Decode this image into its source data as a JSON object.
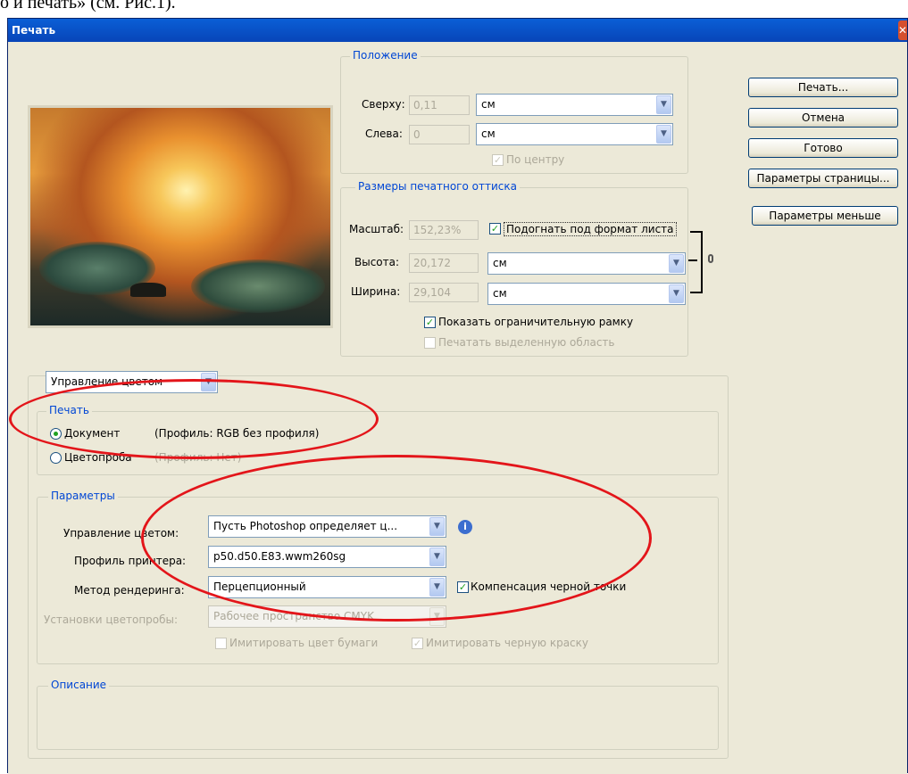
{
  "doc_text": "о и печать» (см. Рис.1).",
  "window": {
    "title": "Печать"
  },
  "position": {
    "legend": "Положение",
    "top_label": "Сверху:",
    "top_value": "0,11",
    "top_unit": "см",
    "left_label": "Слева:",
    "left_value": "0",
    "left_unit": "см",
    "center_label": "По центру"
  },
  "print_size": {
    "legend": "Размеры печатного оттиска",
    "scale_label": "Масштаб:",
    "scale_value": "152,23%",
    "fit_label": "Подогнать под формат листа",
    "height_label": "Высота:",
    "height_value": "20,172",
    "height_unit": "см",
    "width_label": "Ширина:",
    "width_value": "29,104",
    "width_unit": "см",
    "bbox_label": "Показать ограничительную рамку",
    "print_selection_label": "Печатать выделенную область"
  },
  "buttons": {
    "print": "Печать...",
    "cancel": "Отмена",
    "done": "Готово",
    "page_setup": "Параметры страницы...",
    "fewer_options": "Параметры меньше"
  },
  "color_mgmt": {
    "dropdown": "Управление цветом",
    "print_legend": "Печать",
    "document_label": "Документ",
    "document_profile": "(Профиль: RGB без профиля)",
    "proof_label": "Цветопроба",
    "proof_profile": "(Профиль: Нет)"
  },
  "options": {
    "legend": "Параметры",
    "cm_label": "Управление цветом:",
    "cm_value": "Пусть Photoshop определяет ц...",
    "printer_label": "Профиль принтера:",
    "printer_value": "p50.d50.E83.wwm260sg",
    "render_label": "Метод рендеринга:",
    "render_value": "Перцепционный",
    "bpc_label": "Компенсация черной точки",
    "proof_setup_label": "Установки цветопробы:",
    "proof_setup_value": "Рабочее пространство CMYK",
    "simulate_paper_label": "Имитировать цвет бумаги",
    "simulate_black_label": "Имитировать черную краску"
  },
  "description": {
    "legend": "Описание"
  },
  "colors": {
    "annotation": "#e3151a",
    "legend_text": "#0046d5",
    "dialog_bg": "#ece9d8"
  }
}
